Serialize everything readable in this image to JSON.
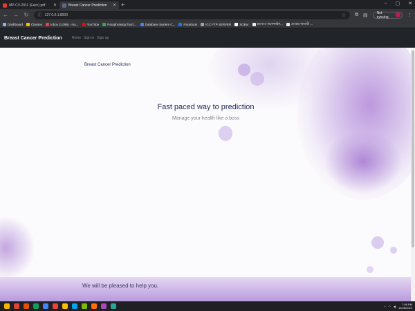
{
  "browser": {
    "tabs": [
      {
        "title": "MP-CV-2011 (Exec) pdf",
        "active": false,
        "favicon_color": "#e53935"
      },
      {
        "title": "Breast Cancer Prediction",
        "active": true,
        "favicon_color": "#5b6b8c"
      }
    ],
    "new_tab_glyph": "+",
    "window_controls": [
      "–",
      "▢",
      "✕"
    ],
    "url": "127.0.0.1:8000",
    "profile_label": "Not syncing",
    "bookmarks": [
      {
        "label": "Dashboard",
        "color": "#8ab4f8"
      },
      {
        "label": "Classes",
        "color": "#fbbc04"
      },
      {
        "label": "Inbox (1,095) - mo...",
        "color": "#ea4335"
      },
      {
        "label": "YouTube",
        "color": "#ff0000"
      },
      {
        "label": "Paraphrasing Tool |...",
        "color": "#34a853"
      },
      {
        "label": "Database System C...",
        "color": "#4285f4"
      },
      {
        "label": "Facebook",
        "color": "#1877f2"
      },
      {
        "label": "ICC FTP SERVER",
        "color": "#9aa0a6"
      },
      {
        "label": "SGBor",
        "color": "#ffffff"
      },
      {
        "label": "হয় যাও অফেলাইন...",
        "color": "#e8eaed"
      },
      {
        "label": "প্রান্তের অধ্যায়ী ...",
        "color": "#e8eaed"
      }
    ]
  },
  "site": {
    "brand": "Breast Cancer Prediction",
    "nav_links": [
      "Home",
      "Sign in",
      "Sign up"
    ],
    "page_brand": "Breast Cancer Prediction",
    "headline": "Fast paced way to prediction",
    "tagline": "Manage your health like a boss",
    "footer_text": "We will be pleased to help you."
  },
  "taskbar": {
    "time": "7:08 PM",
    "date": "12/08/2022",
    "app_colors": [
      "#f4b400",
      "#db4437",
      "#e65100",
      "#0f9d58",
      "#4285f4",
      "#ea4335",
      "#fbbc04",
      "#00a1f1",
      "#7cbb00",
      "#ff6f00",
      "#ab47bc",
      "#26a69a"
    ]
  },
  "colors": {
    "accent_purple": "#a777d3",
    "navbar_bg": "#212529"
  }
}
